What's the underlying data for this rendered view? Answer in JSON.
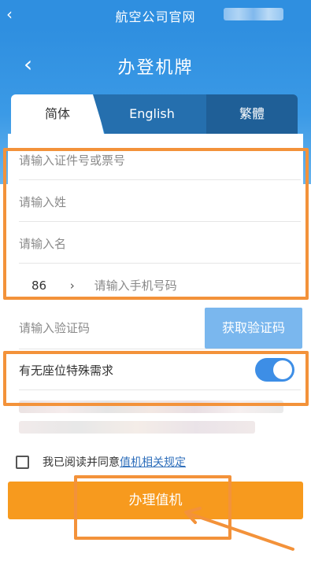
{
  "topbar": {
    "back_glyph": "‹",
    "title": "航空公司官网"
  },
  "page": {
    "back_glyph": "‹",
    "title": "办登机牌"
  },
  "tabs": [
    {
      "label": "简体",
      "active": true
    },
    {
      "label": "English",
      "active": false
    },
    {
      "label": "繁體",
      "active": false
    }
  ],
  "form": {
    "id_or_ticket_placeholder": "请输入证件号或票号",
    "surname_placeholder": "请输入姓",
    "given_name_placeholder": "请输入名",
    "country_code": "86",
    "country_code_chevron": "›",
    "phone_placeholder": "请输入手机号码",
    "verify_placeholder": "请输入验证码",
    "get_code_label": "获取验证码",
    "seat_request_label": "有无座位特殊需求",
    "seat_request_on": true
  },
  "agreement": {
    "checked": false,
    "text": "我已阅读并同意",
    "link": "值机相关规定"
  },
  "submit_label": "办理值机",
  "colors": {
    "primary": "#2f8fe0",
    "accent": "#f79a1e",
    "highlight": "#f3923a",
    "toggle_on": "#3d8ee6"
  },
  "icons": [
    "back-chevron-icon",
    "chevron-right-icon",
    "toggle-switch-icon",
    "checkbox-icon"
  ]
}
